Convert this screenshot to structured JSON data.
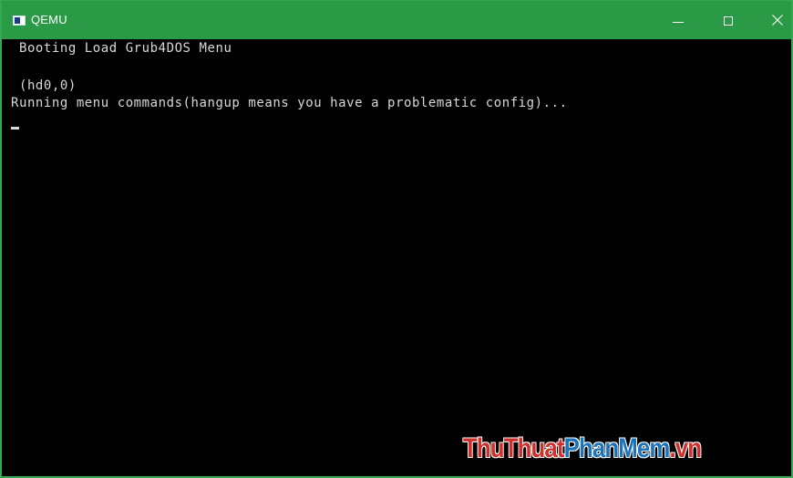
{
  "window": {
    "title": "QEMU",
    "icon": "qemu-app-icon",
    "controls": {
      "minimize_icon": "minimize-icon",
      "maximize_icon": "maximize-icon",
      "close_icon": "close-icon"
    }
  },
  "console": {
    "lines": [
      " Booting Load Grub4DOS Menu",
      " (hd0,0)",
      "Running menu commands(hangup means you have a problematic config)..."
    ],
    "cursor": "_"
  },
  "watermark": {
    "part1": "ThuThuat",
    "part2": "PhanMem",
    "part3": ".vn"
  },
  "colors": {
    "titlebar": "#2a9a46",
    "console_bg": "#000000",
    "console_text": "#d8d8d8",
    "watermark_red": "#d0302a",
    "watermark_blue": "#1c73b8"
  }
}
